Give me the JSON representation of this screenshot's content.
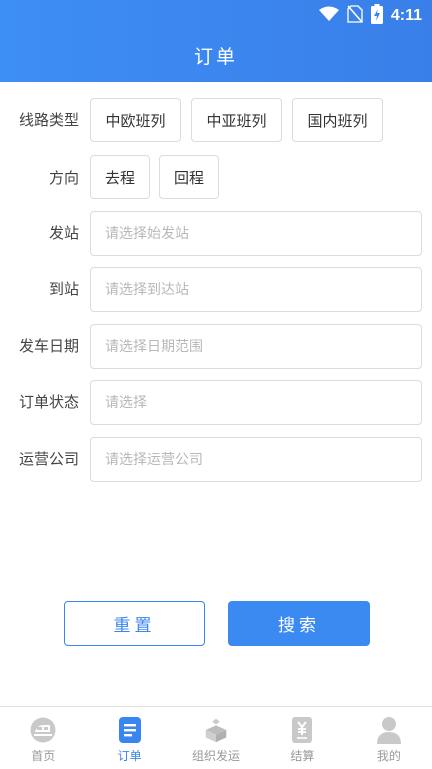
{
  "status_bar": {
    "time": "4:11"
  },
  "header": {
    "title": "订单"
  },
  "form": {
    "route_type": {
      "label": "线路类型",
      "options": [
        "中欧班列",
        "中亚班列",
        "国内班列"
      ]
    },
    "direction": {
      "label": "方向",
      "options": [
        "去程",
        "回程"
      ]
    },
    "departure": {
      "label": "发站",
      "placeholder": "请选择始发站"
    },
    "arrival": {
      "label": "到站",
      "placeholder": "请选择到达站"
    },
    "date": {
      "label": "发车日期",
      "placeholder": "请选择日期范围"
    },
    "status": {
      "label": "订单状态",
      "placeholder": "请选择"
    },
    "operator": {
      "label": "运营公司",
      "placeholder": "请选择运营公司"
    }
  },
  "actions": {
    "reset": "重置",
    "search": "搜索"
  },
  "tabbar": {
    "active_color": "#3a86f0",
    "items": [
      {
        "label": "首页",
        "icon": "home-train-icon",
        "active": false
      },
      {
        "label": "订单",
        "icon": "order-doc-icon",
        "active": true
      },
      {
        "label": "组织发运",
        "icon": "shipping-icon",
        "active": false
      },
      {
        "label": "结算",
        "icon": "settlement-yen-icon",
        "active": false
      },
      {
        "label": "我的",
        "icon": "user-icon",
        "active": false
      }
    ]
  }
}
